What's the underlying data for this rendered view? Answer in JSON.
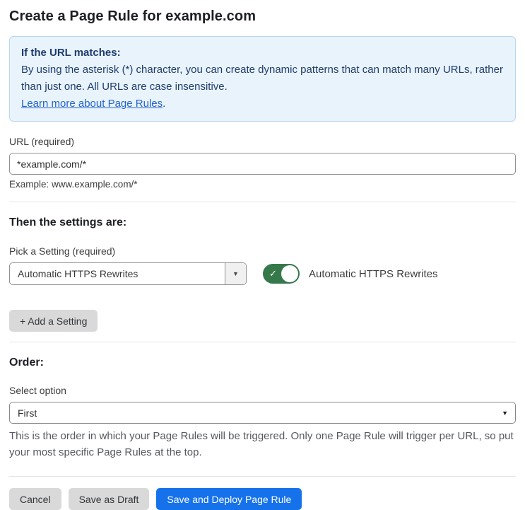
{
  "page": {
    "title": "Create a Page Rule for example.com"
  },
  "info_box": {
    "heading": "If the URL matches:",
    "body": "By using the asterisk (*) character, you can create dynamic patterns that can match many URLs, rather than just one. All URLs are case insensitive.",
    "link_label": "Learn more about Page Rules",
    "link_suffix": "."
  },
  "url_field": {
    "label": "URL (required)",
    "value": "*example.com/*",
    "helper": "Example: www.example.com/*"
  },
  "settings_section": {
    "heading": "Then the settings are:",
    "picker_label": "Pick a Setting (required)",
    "selected_setting": "Automatic HTTPS Rewrites",
    "dropdown_arrow": "▼",
    "toggle": {
      "state": "on",
      "check_glyph": "✓",
      "label": "Automatic HTTPS Rewrites"
    },
    "add_setting_label": "+ Add a Setting"
  },
  "order_section": {
    "heading": "Order:",
    "select_label": "Select option",
    "selected_option": "First",
    "dropdown_arrow": "▼",
    "helper": "This is the order in which your Page Rules will be triggered. Only one Page Rule will trigger per URL, so put your most specific Page Rules at the top."
  },
  "footer": {
    "cancel_label": "Cancel",
    "save_draft_label": "Save as Draft",
    "save_deploy_label": "Save and Deploy Page Rule"
  },
  "colors": {
    "info_bg": "#e9f3fc",
    "info_border": "#b9d6f1",
    "info_text": "#1e3c6e",
    "link": "#2264cb",
    "toggle_green": "#35794b",
    "primary_blue": "#1672eb",
    "button_gray": "#d9d9d9"
  }
}
